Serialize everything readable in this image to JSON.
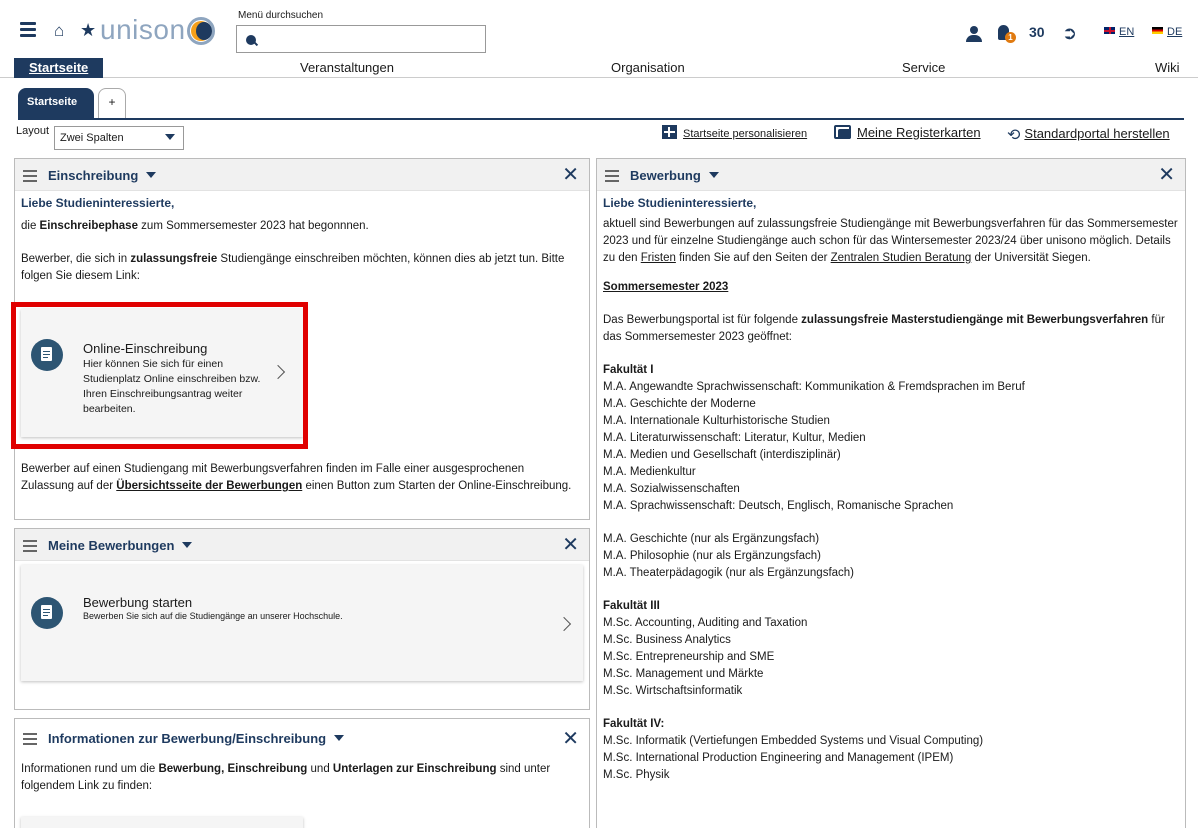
{
  "header": {
    "logo_text": "unison",
    "search_label": "Menü durchsuchen",
    "search_placeholder": "",
    "notification_count": "1",
    "session_timer": "30",
    "lang_en": "EN",
    "lang_de": "DE"
  },
  "nav": {
    "items": [
      "Startseite",
      "Veranstaltungen",
      "Organisation",
      "Service",
      "Wiki"
    ]
  },
  "tabs": {
    "home": "Startseite",
    "add": "+"
  },
  "layout": {
    "label": "Layout",
    "value": "Zwei Spalten"
  },
  "toolbar": {
    "personalize": "Startseite personalisieren",
    "my_tabs": "Meine Registerkarten",
    "reset": "Standardportal herstellen"
  },
  "einschreibung": {
    "title": "Einschreibung",
    "greeting": "Liebe Studieninteressierte,",
    "l1a": "die ",
    "l1b": "Einschreibephase",
    "l1c": " zum Sommersemester 2023 hat begonnnen.",
    "l2a": "Bewerber, die sich in ",
    "l2b": "zulassungsfreie",
    "l2c": " Studiengänge einschreiben möchten, können dies ab jetzt tun. Bitte folgen Sie diesem Link:",
    "card_title": "Online-Einschreibung",
    "card_text": "Hier können Sie sich für einen Studienplatz Online einschreiben bzw. Ihren Einschreibungsantrag weiter bearbeiten.",
    "l3a": "Bewerber auf einen Studiengang mit Bewerbungsverfahren finden im Falle einer ausgesprochenen Zulassung auf der ",
    "l3b": "Übersichtsseite der Bewerbungen",
    "l3c": " einen Button zum Starten der Online-Einschreibung."
  },
  "meine_bewerbungen": {
    "title": "Meine Bewerbungen",
    "card_title": "Bewerbung starten",
    "card_text": "Bewerben Sie sich auf die Studiengänge an unserer Hochschule."
  },
  "informationen": {
    "title": "Informationen zur Bewerbung/Einschreibung",
    "t1": "Informationen rund um die ",
    "t2": "Bewerbung, Einschreibung",
    "t3": " und ",
    "t4": "Unterlagen zur Einschreibung",
    "t5": " sind unter folgendem Link zu finden:"
  },
  "bewerbung": {
    "title": "Bewerbung",
    "greeting": "Liebe Studieninteressierte,",
    "p1a": "aktuell sind Bewerbungen auf zulassungsfreie Studiengänge mit Bewerbungsverfahren für das Sommersemester 2023 und für einzelne Studiengänge auch schon für das Wintersemester 2023/24 über unisono möglich. Details zu den ",
    "p1b": "Fristen",
    "p1c": " finden Sie auf den Seiten der ",
    "p1d": "Zentralen Studien Beratung",
    "p1e": " der Universität Siegen.",
    "semester": "Sommersemester 2023",
    "p2a": "Das Bewerbungsportal ist für folgende ",
    "p2b": "zulassungsfreie Masterstudiengänge mit Bewerbungsverfahren",
    "p2c": " für das Sommersemester 2023 geöffnet:",
    "fak1": "Fakultät I",
    "fak1_items": [
      "M.A. Angewandte Sprachwissenschaft: Kommunikation & Fremdsprachen im Beruf",
      "M.A. Geschichte der Moderne",
      "M.A. Internationale Kulturhistorische Studien",
      "M.A. Literaturwissenschaft: Literatur, Kultur, Medien",
      "M.A. Medien und Gesellschaft (interdisziplinär)",
      "M.A. Medienkultur",
      "M.A. Sozialwissenschaften",
      "M.A. Sprachwissenschaft: Deutsch, Englisch, Romanische Sprachen"
    ],
    "fak1_extra": [
      "M.A. Geschichte (nur als Ergänzungsfach)",
      "M.A. Philosophie (nur als Ergänzungsfach)",
      "M.A. Theaterpädagogik (nur als Ergänzungsfach)"
    ],
    "fak3": "Fakultät III",
    "fak3_items": [
      "M.Sc. Accounting, Auditing and Taxation",
      "M.Sc. Business Analytics",
      "M.Sc. Entrepreneurship and SME",
      "M.Sc. Management und Märkte",
      "M.Sc. Wirtschaftsinformatik"
    ],
    "fak4": "Fakultät IV:",
    "fak4_items": [
      "M.Sc. Informatik (Vertiefungen Embedded Systems und Visual Computing)",
      "M.Sc. International Production Engineering and Management (IPEM)",
      "M.Sc. Physik"
    ]
  }
}
